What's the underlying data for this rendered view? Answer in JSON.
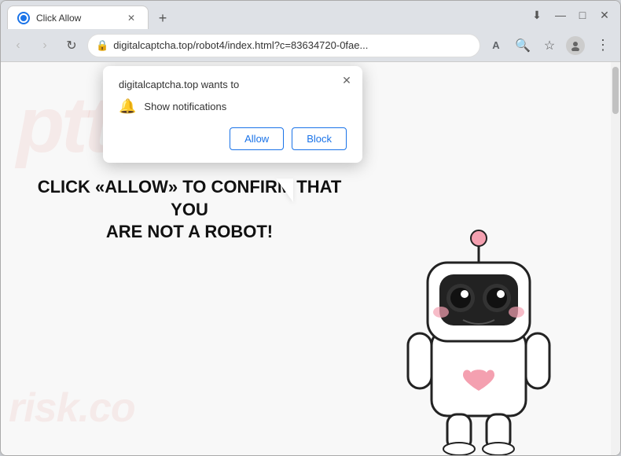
{
  "browser": {
    "tab": {
      "title": "Click Allow",
      "favicon": "globe"
    },
    "new_tab_label": "+",
    "window_controls": {
      "minimize": "—",
      "maximize": "□",
      "close": "✕"
    },
    "toolbar": {
      "back": "‹",
      "forward": "›",
      "refresh": "↻",
      "address": "digitalcaptcha.top/robot4/index.html?c=83634720-0fae...",
      "address_full": "digitalcaptcha.top/robot4/index.html?c=83634720-0fae...",
      "lock": "🔒",
      "translate_icon": "A",
      "search_icon": "🔍",
      "bookmark_icon": "☆",
      "profile_icon": "👤",
      "menu_icon": "⋮"
    }
  },
  "notification_popup": {
    "site": "digitalcaptcha.top wants to",
    "notification_label": "Show notifications",
    "close_icon": "✕",
    "bell_icon": "🔔",
    "allow_label": "Allow",
    "block_label": "Block"
  },
  "page": {
    "main_text_line1": "CLICK «ALLOW» TO CONFIRM THAT YOU",
    "main_text_line2": "ARE NOT A ROBOT!",
    "watermark_logo": "ptt",
    "watermark_bottom": "risk.co"
  }
}
